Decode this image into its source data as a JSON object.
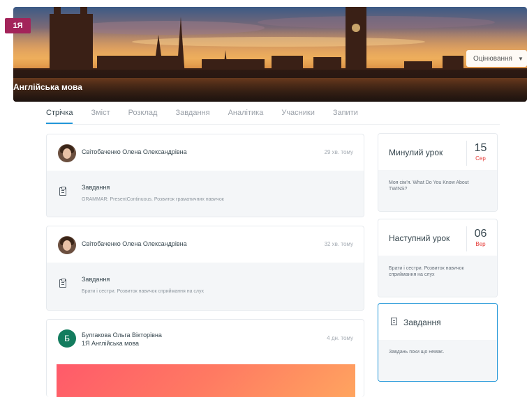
{
  "banner": {
    "class_badge": "1Я",
    "title": "Англійська мова",
    "grading_button": "Оцінювання"
  },
  "tabs": [
    "Стрічка",
    "Зміст",
    "Розклад",
    "Завдання",
    "Аналітика",
    "Учасники",
    "Запити"
  ],
  "feed": [
    {
      "author": "Світобаченко Олена Олександрівна",
      "time": "29 хв. тому",
      "task_label": "Завдання",
      "task_desc": "GRAMMAR: PresentContinuous. Розвиток граматичних навичок"
    },
    {
      "author": "Світобаченко Олена Олександрівна",
      "time": "32 хв. тому",
      "task_label": "Завдання",
      "task_desc": "Брати і сестри. Розвиток навичок сприймання на слух"
    },
    {
      "avatar_letter": "Б",
      "author": "Булгакова Ольга Вікторівна",
      "subtitle": "1Я Англійська мова",
      "time": "4 дн. тому"
    }
  ],
  "sidebar": {
    "previous": {
      "title": "Минулий урок",
      "day": "15",
      "month": "Сер",
      "text": "Моя сім'я. What Do You Know About TWINS?"
    },
    "next": {
      "title": "Наступний урок",
      "day": "06",
      "month": "Вер",
      "text": "Брати і сестри. Розвиток навичок сприймання на слух"
    },
    "tasks": {
      "title": "Завдання",
      "empty_text": "Завдань поки що немає."
    }
  },
  "colors": {
    "accent": "#2196d8",
    "badge": "#a3245a",
    "month_red": "#e53935",
    "avatar_green": "#137c5e"
  }
}
